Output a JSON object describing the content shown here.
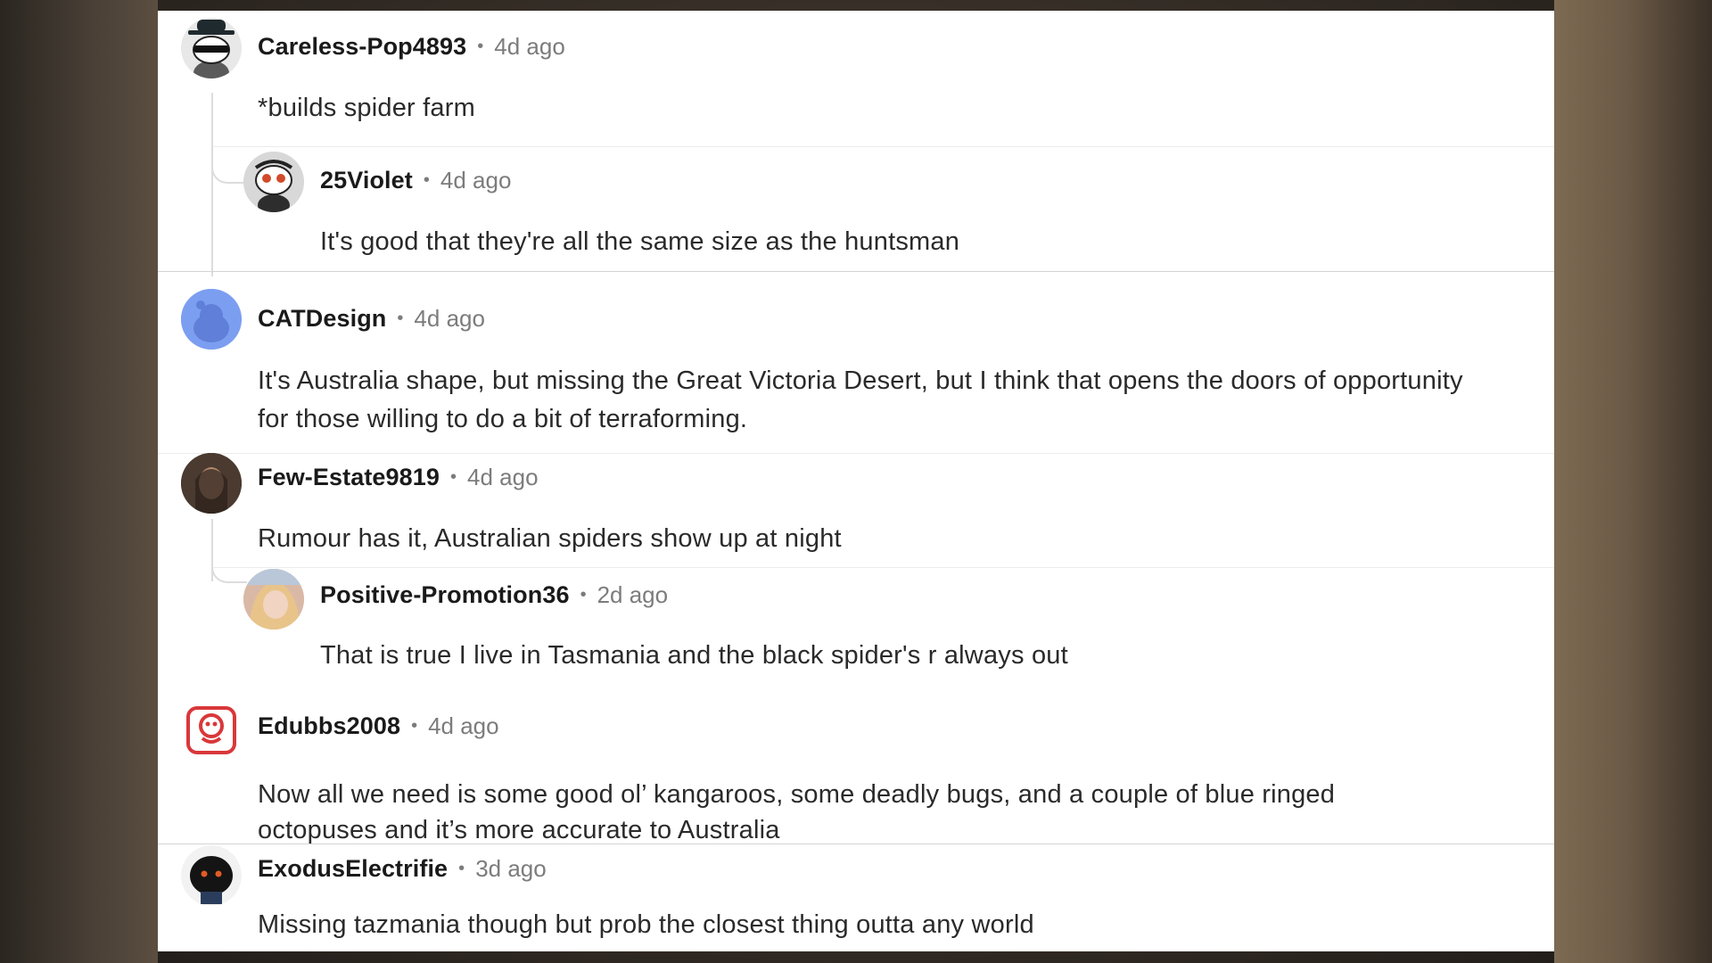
{
  "comments": [
    {
      "username": "Careless-Pop4893",
      "time": "4d ago",
      "text": "*builds spider farm"
    },
    {
      "username": "25Violet",
      "time": "4d ago",
      "text": "It's good that they're all the same size as the huntsman"
    },
    {
      "username": "CATDesign",
      "time": "4d ago",
      "text": "It's Australia shape, but missing the Great Victoria Desert, but I think that opens the doors of opportunity for those willing to do a bit of terraforming."
    },
    {
      "username": "Few-Estate9819",
      "time": "4d ago",
      "text": "Rumour has it, Australian spiders show up at night"
    },
    {
      "username": "Positive-Promotion36",
      "time": "2d ago",
      "text": "That is true I live in Tasmania and the black spider's r always out"
    },
    {
      "username": "Edubbs2008",
      "time": "4d ago",
      "text": "Now all we need is some good ol’ kangaroos, some deadly bugs, and a couple of blue ringed octopuses and it’s more accurate to Australia"
    },
    {
      "username": "ExodusElectrifie",
      "time": "3d ago",
      "text": "Missing tazmania though but prob the closest thing outta any world"
    }
  ],
  "separator": "•",
  "colors": {
    "username": "#1a1a1b",
    "meta": "#7c7c7c",
    "body": "#2a2a2a",
    "divider": "#d4d4d4"
  }
}
